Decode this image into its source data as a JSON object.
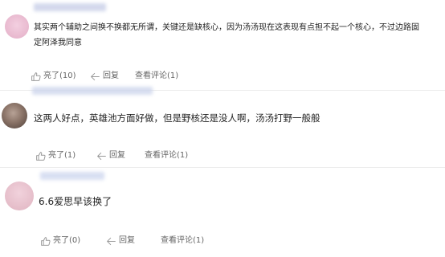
{
  "comments": [
    {
      "text_line1": "其实两个辅助之间换不换都无所谓，关键还是缺核心，因为汤汤现在这表现有点担不起一个核心，不过边路固",
      "text_line2": "定阿泽我同意",
      "like_label": "亮了(10)",
      "reply_label": "回复",
      "view_label": "查看评论(1)"
    },
    {
      "text": "这两人好点，英雄池方面好做，但是野核还是没人啊，汤汤打野一般般",
      "like_label": "亮了(1)",
      "reply_label": "回复",
      "view_label": "查看评论(1)"
    },
    {
      "text": "6.6爱思早该换了",
      "like_label": "亮了(0)",
      "reply_label": "回复",
      "view_label": "查看评论(1)"
    }
  ],
  "icons": {
    "like": "thumbs-up-icon",
    "reply": "reply-arrow-icon"
  },
  "colors": {
    "text": "#1f1f1f",
    "meta": "#666666",
    "icon": "#999999"
  }
}
